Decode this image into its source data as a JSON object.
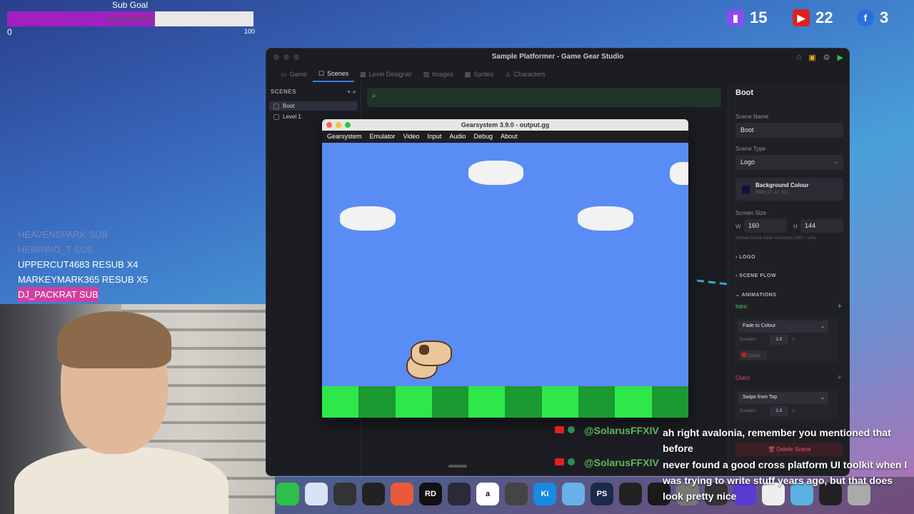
{
  "subgoal": {
    "title": "Sub Goal",
    "progress_text": "60 (60.00%)",
    "progress_fraction": 0.6,
    "min": "0",
    "max": "100",
    "fill_color": "#a020c0"
  },
  "social": {
    "twitch_count": "15",
    "youtube_count": "22",
    "facebook_count": "3"
  },
  "events": [
    {
      "text": "HEAVENSPARK SUB"
    },
    {
      "text": "HERRING_T SUB"
    },
    {
      "text": "UPPERCUT4683 RESUB X4"
    },
    {
      "text": "MARKEYMARK365 RESUB X5"
    },
    {
      "text": "DJ_PACKRAT SUB"
    }
  ],
  "studio": {
    "title": "Sample Platformer - Game Gear Studio",
    "tabs": [
      {
        "label": "Game",
        "icon": "gamepad-icon"
      },
      {
        "label": "Scenes",
        "icon": "scene-icon"
      },
      {
        "label": "Level Designer",
        "icon": "grid-icon"
      },
      {
        "label": "Images",
        "icon": "image-icon"
      },
      {
        "label": "Sprites",
        "icon": "sprite-icon"
      },
      {
        "label": "Characters",
        "icon": "person-icon"
      }
    ],
    "scenes_header": "SCENES",
    "scenes": [
      "Boot",
      "Level 1"
    ],
    "inspector": {
      "title": "Boot",
      "scene_name_label": "Scene Name",
      "scene_name_value": "Boot",
      "scene_type_label": "Scene Type",
      "scene_type_value": "Logo",
      "bg_colour_label": "Background Colour",
      "bg_colour_value": "RGB (17, 17, 51)",
      "screen_size_label": "Screen Size",
      "w_label": "W",
      "w_value": "160",
      "h_label": "H",
      "h_value": "144",
      "default_note": "Default Game Gear resolution (160 × 144)",
      "section_logo": "LOGO",
      "section_flow": "SCENE FLOW",
      "section_anim": "ANIMATIONS",
      "intro_label": "Intro",
      "intro_anim": "Fade to Colour",
      "duration_label": "Duration",
      "duration_value": "1.0",
      "duration_unit": "s",
      "colour_label": "Colour",
      "outro_label": "Outro",
      "outro_anim": "Swipe from Top",
      "outro_duration": "1.0",
      "delete_label": "Delete Scene"
    }
  },
  "emulator": {
    "title": "Gearsystem 3.9.0 - output.gg",
    "menu": [
      "Gearsystem",
      "Emulator",
      "Video",
      "Input",
      "Audio",
      "Debug",
      "About"
    ],
    "sky_color": "#5a8cf6",
    "ground_light": "#2ee84a",
    "ground_dark": "#1a9a30"
  },
  "chat": [
    {
      "user": "@SolarusFFXIV",
      "message": "ah right avalonia, remember you mentioned that before"
    },
    {
      "user": "@SolarusFFXIV",
      "message": "never found a good cross platform UI toolkit when I was trying to write stuff years ago, but that does look pretty nice"
    }
  ],
  "dock": {
    "apps": [
      "messages-icon",
      "preview-icon",
      "shop-icon",
      "github-icon",
      "spark-icon",
      "rider-icon",
      "resolve-icon",
      "amazon-icon",
      "obs-icon",
      "kindle-icon",
      "finder-icon",
      "photoshop-icon",
      "audio-icon",
      "terminal-icon",
      "chrome-icon",
      "app-icon",
      "obs2-icon",
      "gear-studio-icon",
      "downloads-icon",
      "screen-icon",
      "trash-icon"
    ],
    "labels": {
      "rider-icon": "RD",
      "kindle-icon": "Ki",
      "photoshop-icon": "PS",
      "amazon-icon": "a"
    }
  }
}
